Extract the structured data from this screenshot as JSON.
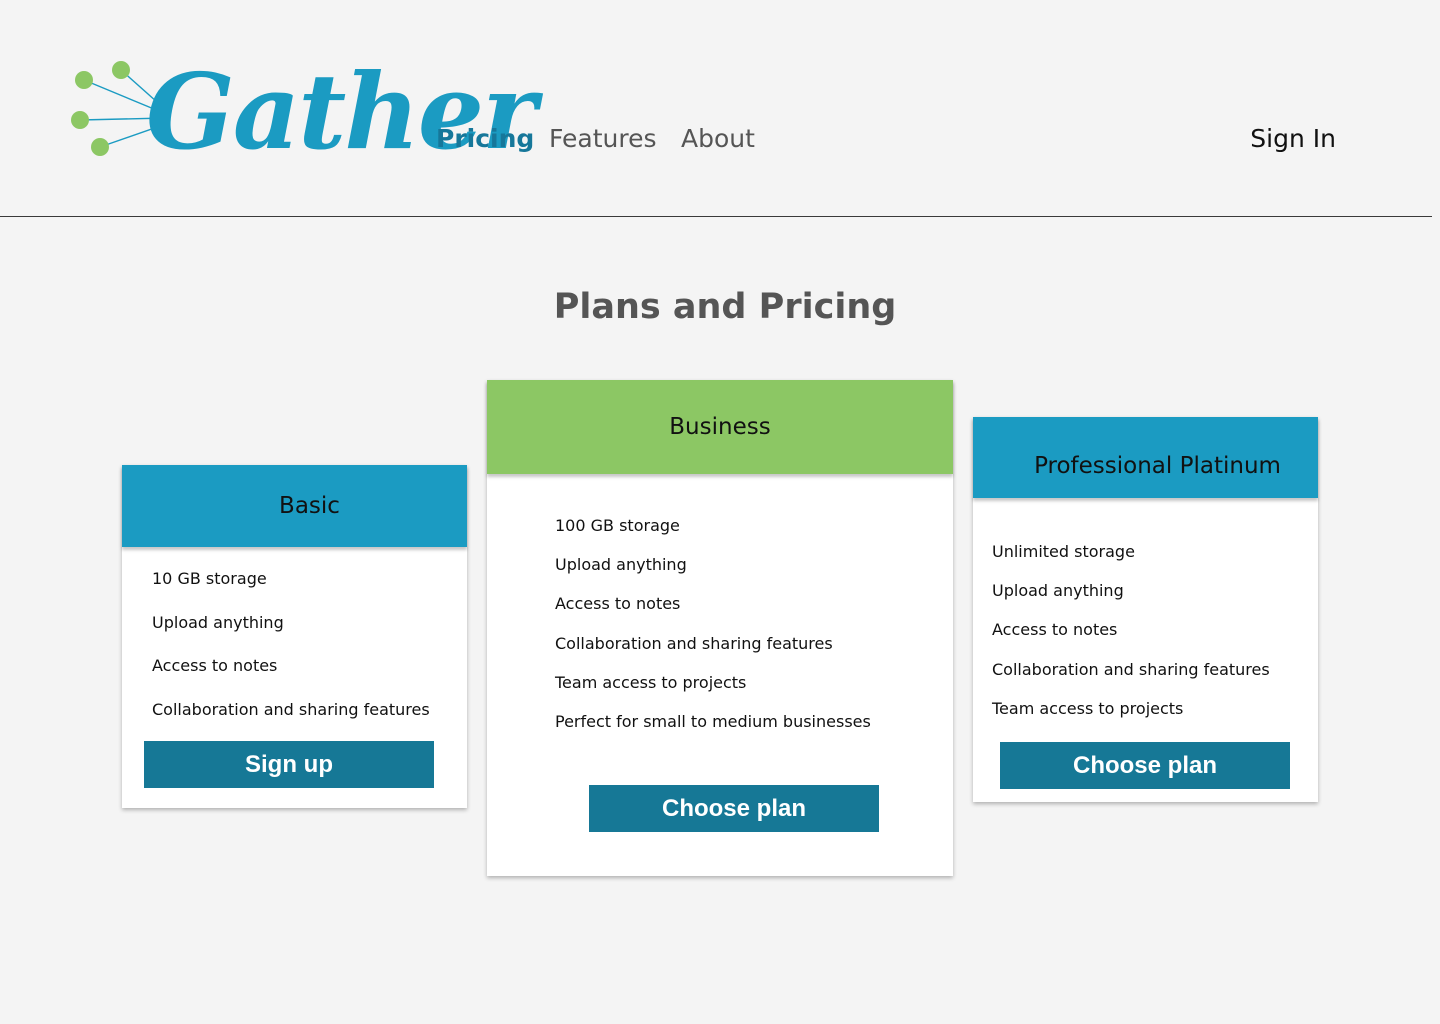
{
  "brand": {
    "name": "Gather",
    "primary_color": "#1b9bc2",
    "accent_color": "#8cc764",
    "button_color": "#167896"
  },
  "nav": {
    "items": [
      {
        "label": "Pricing",
        "active": true
      },
      {
        "label": "Features",
        "active": false
      },
      {
        "label": "About",
        "active": false
      }
    ],
    "sign_in_label": "Sign In"
  },
  "page": {
    "title": "Plans and Pricing"
  },
  "plans": [
    {
      "name": "Basic",
      "header_color": "#1b9bc2",
      "features": [
        "10 GB storage",
        "Upload anything",
        "Access to notes",
        "Collaboration and sharing features"
      ],
      "cta_label": "Sign up"
    },
    {
      "name": "Business",
      "header_color": "#8cc764",
      "features": [
        "100 GB storage",
        "Upload anything",
        "Access to notes",
        "Collaboration and sharing features",
        "Team access to projects",
        "Perfect for small to medium businesses"
      ],
      "cta_label": "Choose plan"
    },
    {
      "name": "Professional Platinum",
      "header_color": "#1b9bc2",
      "features": [
        "Unlimited storage",
        "Upload anything",
        "Access to notes",
        "Collaboration and sharing features",
        "Team access to projects"
      ],
      "cta_label": "Choose plan"
    }
  ]
}
